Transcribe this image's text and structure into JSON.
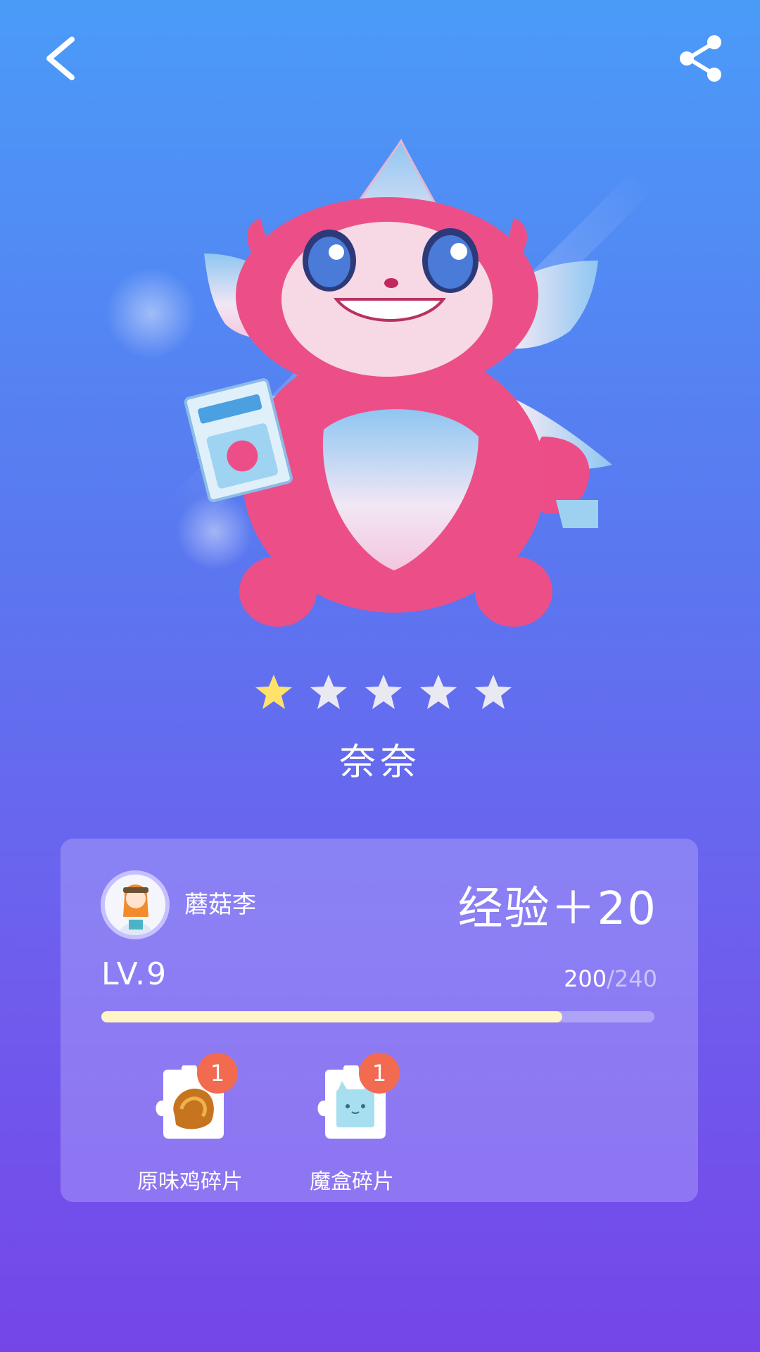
{
  "nav": {
    "back_icon": "chevron-left-icon",
    "share_icon": "share-icon"
  },
  "pet": {
    "name": "奈奈",
    "stars_total": 5,
    "stars_filled": 1
  },
  "colors": {
    "star_active": "#ffe26a",
    "star_inactive": "#e9e9f2",
    "badge": "#f26a50",
    "progress_fill": "#fff5c7"
  },
  "card": {
    "username": "蘑菇李",
    "exp_gain": "经验＋20",
    "level": "LV.9",
    "progress": {
      "current": "200",
      "separator": "/",
      "max": "240",
      "fraction": 0.833
    },
    "items": [
      {
        "label": "原味鸡碎片",
        "count": "1",
        "icon": "fried-chicken-icon"
      },
      {
        "label": "魔盒碎片",
        "count": "1",
        "icon": "cat-box-icon"
      }
    ]
  }
}
